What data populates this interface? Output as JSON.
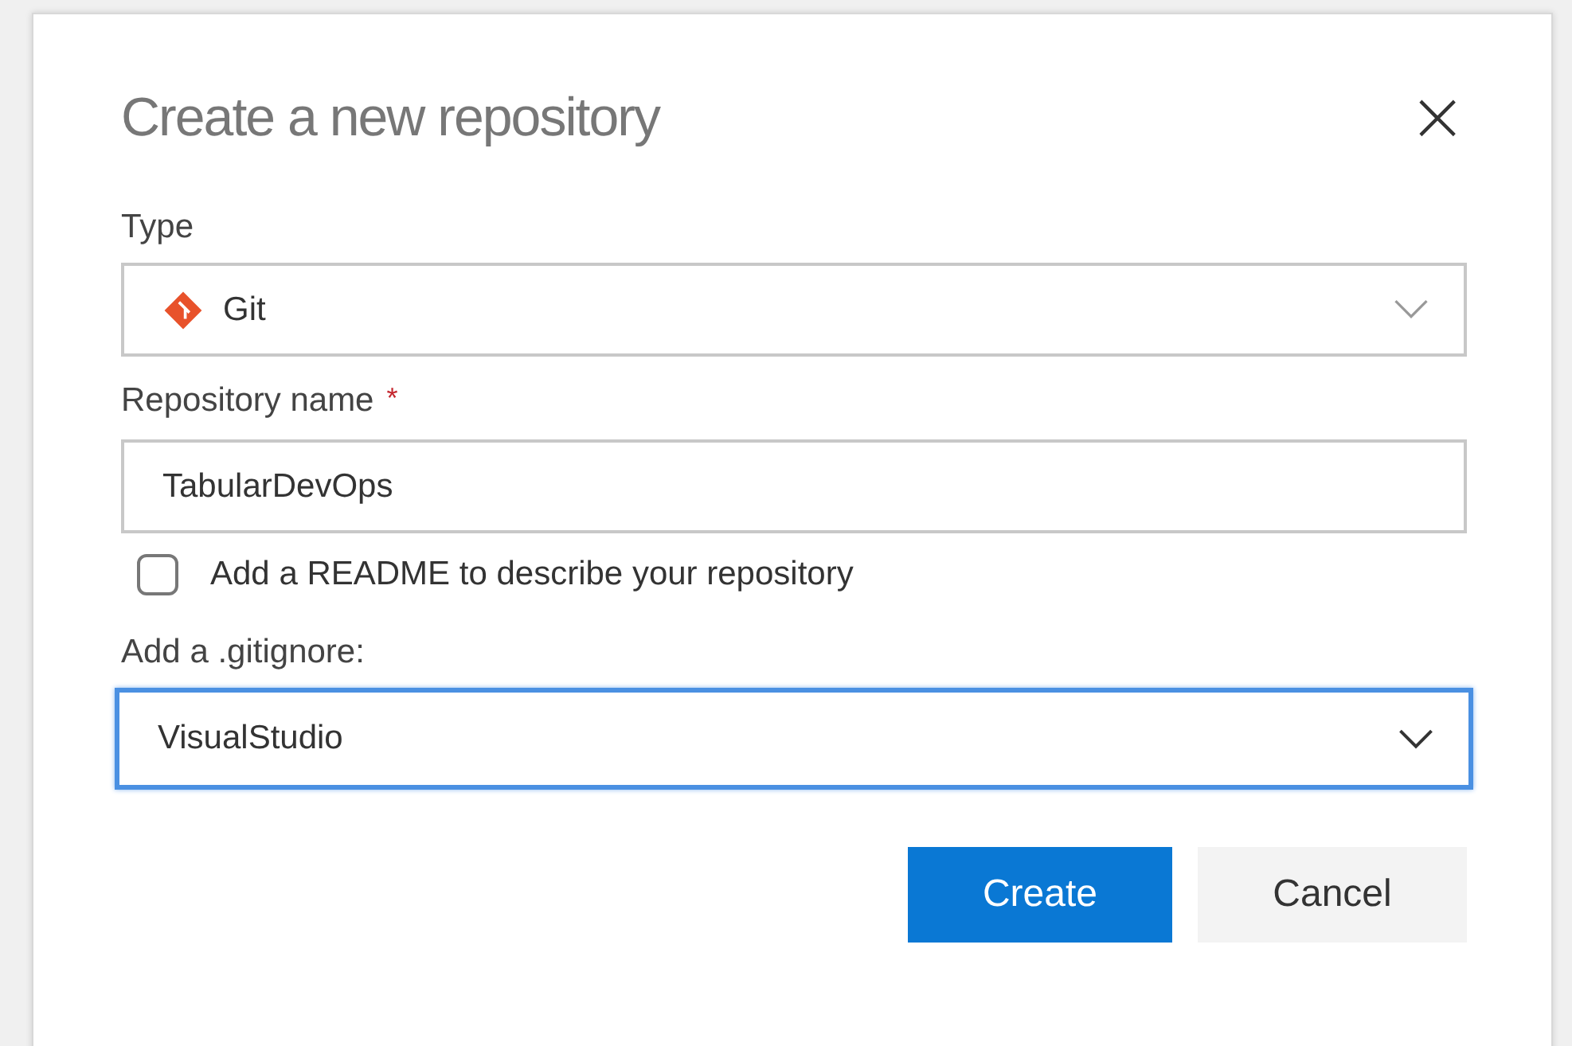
{
  "dialog": {
    "title": "Create a new repository",
    "close": "×"
  },
  "type_field": {
    "label": "Type",
    "value": "Git"
  },
  "name_field": {
    "label": "Repository name",
    "required_mark": "*",
    "value": "TabularDevOps"
  },
  "readme": {
    "label": "Add a README to describe your repository",
    "checked": false
  },
  "gitignore_field": {
    "label": "Add a .gitignore:",
    "value": "VisualStudio",
    "focused": true
  },
  "buttons": [
    {
      "label": "Create",
      "kind": "primary"
    },
    {
      "label": "Cancel",
      "kind": "secondary"
    }
  ]
}
